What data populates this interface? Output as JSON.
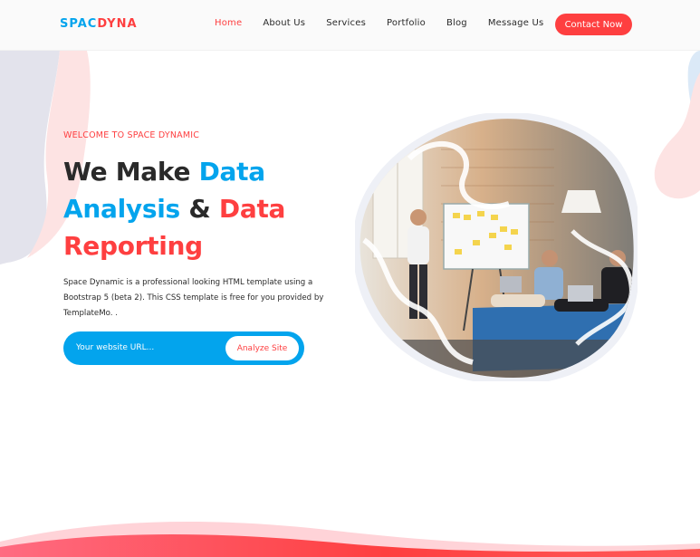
{
  "brand": {
    "part1": "SPAC",
    "part2": "DYNA"
  },
  "nav": {
    "items": [
      {
        "label": "Home",
        "active": true
      },
      {
        "label": "About Us",
        "active": false
      },
      {
        "label": "Services",
        "active": false
      },
      {
        "label": "Portfolio",
        "active": false
      },
      {
        "label": "Blog",
        "active": false
      },
      {
        "label": "Message Us",
        "active": false
      }
    ],
    "cta_label": "Contact Now"
  },
  "hero": {
    "welcome": "WELCOME TO SPACE DYNAMIC",
    "title": {
      "line1_dark": "We Make ",
      "line1_blue": "Data",
      "line2_blue": "Analysis",
      "line2_dark": " & ",
      "line2_red": "Data",
      "line3_red": "Reporting"
    },
    "description": "Space Dynamic is a professional looking HTML template using a Bootstrap 5 (beta 2). This CSS template is free for you provided by TemplateMo. .",
    "search": {
      "placeholder": "Your website URL...",
      "button_label": "Analyze Site"
    },
    "image": {
      "icon": "team-meeting-photo"
    }
  },
  "colors": {
    "blue": "#03a4ed",
    "red": "#fe3f40",
    "dark": "#2a2a2a",
    "blob_gray": "#e3e3ec",
    "blob_pink": "#fde3e3"
  }
}
